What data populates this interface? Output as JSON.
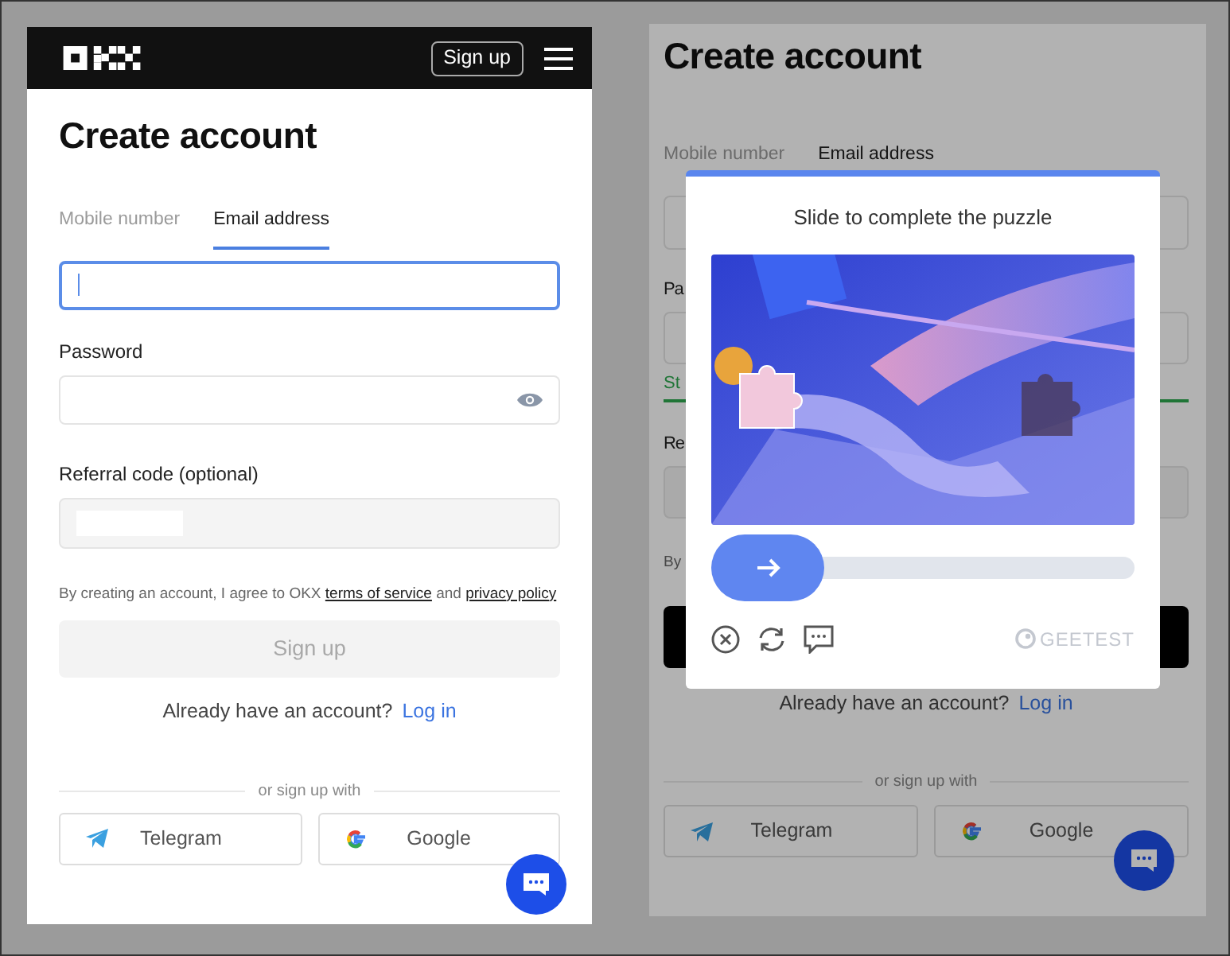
{
  "left": {
    "header": {
      "signup_button": "Sign up"
    },
    "title": "Create account",
    "tabs": [
      {
        "label": "Mobile number",
        "selected": false
      },
      {
        "label": "Email address",
        "selected": true
      }
    ],
    "fields": [
      {
        "kind": "email",
        "focused": true
      },
      {
        "kind": "password",
        "label": "Password",
        "focused": false
      },
      {
        "kind": "referral",
        "label": "Referral code (optional)",
        "focused": false
      }
    ],
    "terms": {
      "text": "By creating an account, I agree to OKX",
      "link_1": "terms of service",
      "joiner": "and",
      "link_2": "privacy policy"
    },
    "submit": {
      "label": "Sign up",
      "disabled": true
    },
    "login_prompt": "Already have an account?",
    "login_link": "Log in",
    "divider": "or sign up with",
    "social": [
      {
        "kind": "telegram",
        "label": "Telegram"
      },
      {
        "kind": "google",
        "label": "Google"
      }
    ]
  },
  "right": {
    "title": "Create account",
    "tabs": [
      {
        "label": "Mobile number",
        "selected": false
      },
      {
        "label": "Email address",
        "selected": true
      }
    ],
    "password_label": "Pa",
    "strength_label": "St",
    "referral_label": "Re",
    "terms": "By",
    "login_prompt": "Already have an account?",
    "login_link": "Log in",
    "divider": "or sign up with",
    "social": [
      {
        "kind": "telegram",
        "label": "Telegram"
      },
      {
        "kind": "google",
        "label": "Google"
      }
    ],
    "captcha": {
      "title": "Slide to complete the puzzle",
      "slider": {
        "level": 0
      },
      "brand": "GEETEST"
    }
  }
}
